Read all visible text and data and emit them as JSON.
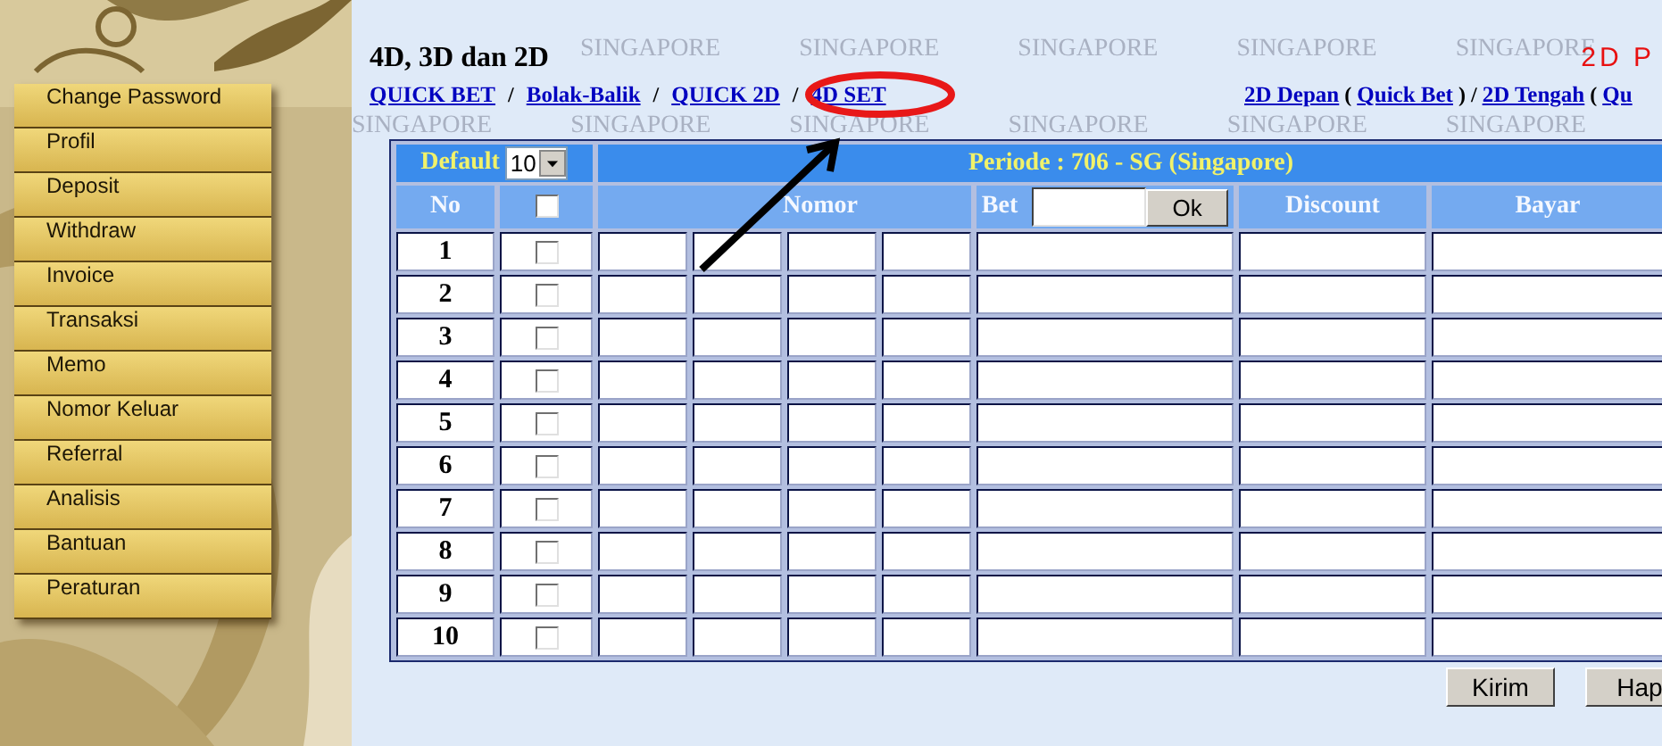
{
  "sidebar": {
    "items": [
      {
        "label": "Change Password"
      },
      {
        "label": "Profil"
      },
      {
        "label": "Deposit"
      },
      {
        "label": "Withdraw"
      },
      {
        "label": "Invoice"
      },
      {
        "label": "Transaksi"
      },
      {
        "label": "Memo"
      },
      {
        "label": "Nomor Keluar"
      },
      {
        "label": "Referral"
      },
      {
        "label": "Analisis"
      },
      {
        "label": "Bantuan"
      },
      {
        "label": "Peraturan"
      }
    ]
  },
  "background_pattern": [
    [
      "SINGAPORE",
      "SINGAPORE",
      "SINGAPORE",
      "SINGAPORE",
      "SINGAPORE"
    ],
    [
      "SINGAPORE",
      "SINGAPORE",
      "SINGAPORE",
      "SINGAPORE",
      "SINGAPORE",
      "SINGAPORE"
    ]
  ],
  "header": {
    "title": "4D, 3D dan 2D",
    "side_title": "2D P",
    "links": [
      {
        "kind": "link",
        "text": "QUICK BET"
      },
      {
        "kind": "sep",
        "text": "/"
      },
      {
        "kind": "link",
        "text": "Bolak-Balik"
      },
      {
        "kind": "sep",
        "text": "/"
      },
      {
        "kind": "link",
        "text": "QUICK 2D"
      },
      {
        "kind": "sep",
        "text": "/"
      },
      {
        "kind": "link",
        "text": "4D SET"
      }
    ],
    "side_links": [
      {
        "kind": "link",
        "text": "2D Depan"
      },
      {
        "kind": "sep",
        "text": "("
      },
      {
        "kind": "link",
        "text": "Quick Bet"
      },
      {
        "kind": "sep",
        "text": ")"
      },
      {
        "kind": "sep",
        "text": "/"
      },
      {
        "kind": "link",
        "text": "2D Tengah"
      },
      {
        "kind": "sep",
        "text": "("
      },
      {
        "kind": "link",
        "text": "Qu"
      }
    ]
  },
  "table": {
    "default_label": "Default",
    "default_value": "10",
    "period": "Periode : 706 - SG (Singapore)",
    "columns": [
      {
        "kind": "text",
        "label": "No"
      },
      {
        "kind": "checkbox",
        "checked": false
      },
      {
        "kind": "text",
        "label": "Nomor"
      },
      {
        "kind": "bet",
        "label": "Bet",
        "button": "Ok"
      },
      {
        "kind": "text",
        "label": "Discount"
      },
      {
        "kind": "text",
        "label": "Bayar"
      }
    ],
    "rows": [
      {
        "no": "1",
        "checked": false
      },
      {
        "no": "2",
        "checked": false
      },
      {
        "no": "3",
        "checked": false
      },
      {
        "no": "4",
        "checked": false
      },
      {
        "no": "5",
        "checked": false
      },
      {
        "no": "6",
        "checked": false
      },
      {
        "no": "7",
        "checked": false
      },
      {
        "no": "8",
        "checked": false
      },
      {
        "no": "9",
        "checked": false
      },
      {
        "no": "10",
        "checked": false
      }
    ]
  },
  "buttons": [
    "Kirim",
    "Hap"
  ]
}
